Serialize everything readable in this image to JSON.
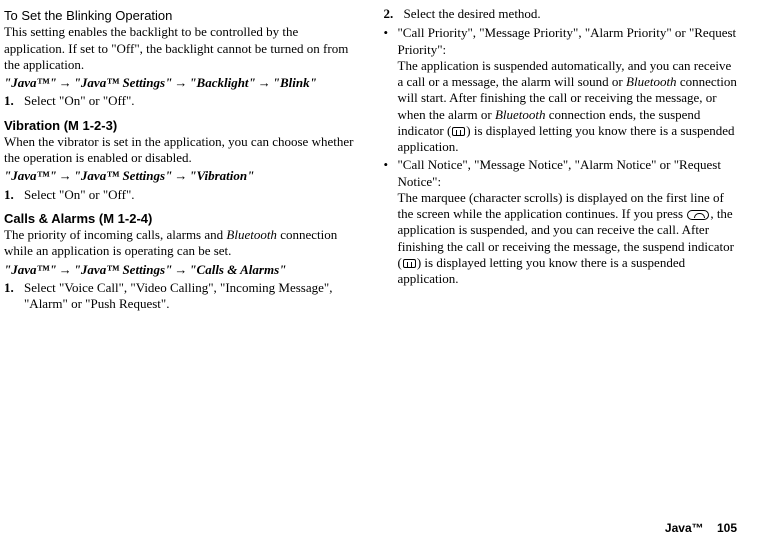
{
  "left": {
    "blink": {
      "title": "To Set the Blinking Operation",
      "desc": "This setting enables the backlight to be controlled by the application. If set to \"Off\", the backlight cannot be turned on from the application.",
      "p1": "\"Java™\"",
      "p2": "\"Java™ Settings\"",
      "p3": "\"Backlight\"",
      "p4": "\"Blink\"",
      "step1num": "1.",
      "step1": "Select \"On\" or \"Off\"."
    },
    "vibration": {
      "title": "Vibration",
      "menucode": " (M 1-2-3)",
      "desc": "When the vibrator is set in the application, you can choose whether the operation is enabled or disabled.",
      "p1": "\"Java™\"",
      "p2": "\"Java™ Settings\"",
      "p3": "\"Vibration\"",
      "step1num": "1.",
      "step1": "Select \"On\" or \"Off\"."
    },
    "calls": {
      "title": "Calls & Alarms",
      "menucode": " (M 1-2-4)",
      "desc1": "The priority of incoming calls, alarms and ",
      "desc_bt": "Bluetooth",
      "desc2": " connection while an application is operating can be set.",
      "p1": "\"Java™\"",
      "p2": "\"Java™ Settings\"",
      "p3": "\"Calls & Alarms\"",
      "step1num": "1.",
      "step1": "Select \"Voice Call\", \"Video Calling\", \"Incoming Message\", \"Alarm\" or \"Push Request\"."
    }
  },
  "right": {
    "step2num": "2.",
    "step2": "Select the desired method.",
    "b1": {
      "line1": "\"Call Priority\", \"Message Priority\", \"Alarm Priority\" or \"Request Priority\":",
      "line2a": "The application is suspended automatically, and you can receive a call or a message, the alarm will sound or ",
      "bt1": "Bluetooth",
      "line2b": " connection will start. After finishing the call or receiving the message, or when the alarm or ",
      "bt2": "Bluetooth",
      "line2c": " connection ends, the suspend indicator (",
      "line2d": ") is displayed letting you know there is a suspended application."
    },
    "b2": {
      "line1": "\"Call Notice\", \"Message Notice\", \"Alarm Notice\" or \"Request Notice\":",
      "line2a": "The marquee (character scrolls) is displayed on the first line of the screen while the application continues. If you press ",
      "line2b": ", the application is suspended, and you can receive the call. After finishing the call or receiving the message, the suspend indicator (",
      "line2c": ") is displayed letting you know there is a suspended application."
    }
  },
  "arrow": "→",
  "bullet": "•",
  "footer": {
    "label": "Java™",
    "page": "105"
  }
}
